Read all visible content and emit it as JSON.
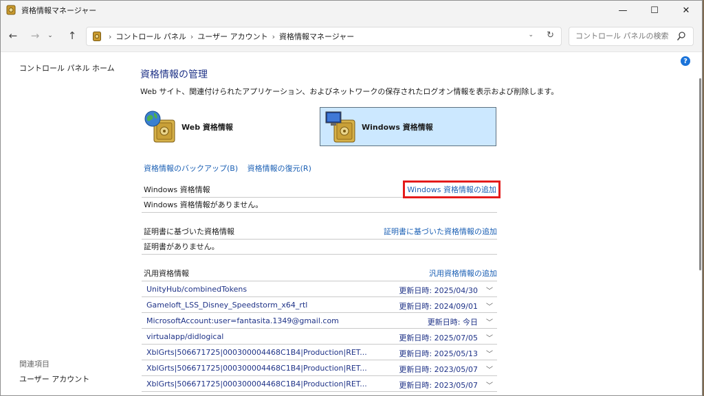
{
  "window": {
    "title": "資格情報マネージャー",
    "minimize": "—",
    "maximize": "☐",
    "close": "✕"
  },
  "nav": {
    "back": "←",
    "forward": "→",
    "recent": "⌄",
    "up": "↑",
    "breadcrumbs": [
      "コントロール パネル",
      "ユーザー アカウント",
      "資格情報マネージャー"
    ],
    "separator": "›",
    "dropdown": "⌄",
    "refresh": "↻",
    "search_placeholder": "コントロール パネルの検索"
  },
  "sidebar": {
    "home": "コントロール パネル ホーム",
    "related_heading": "関連項目",
    "related_user_accounts": "ユーザー アカウント"
  },
  "main": {
    "title": "資格情報の管理",
    "description": "Web サイト、関連付けられたアプリケーション、およびネットワークの保存されたログオン情報を表示および削除します。",
    "tiles": [
      {
        "label": "Web 資格情報",
        "selected": false
      },
      {
        "label": "Windows 資格情報",
        "selected": true
      }
    ],
    "backup_link": "資格情報のバックアップ(B)",
    "restore_link": "資格情報の復元(R)",
    "windows_section": {
      "heading": "Windows 資格情報",
      "add_link": "Windows 資格情報の追加",
      "empty_text": "Windows 資格情報がありません。"
    },
    "cert_section": {
      "heading": "証明書に基づいた資格情報",
      "add_link": "証明書に基づいた資格情報の追加",
      "empty_text": "証明書がありません。"
    },
    "generic_section": {
      "heading": "汎用資格情報",
      "add_link": "汎用資格情報の追加",
      "items": [
        {
          "name": "UnityHub/combinedTokens",
          "date": "更新日時:  2025/04/30"
        },
        {
          "name": "Gameloft_LSS_Disney_Speedstorm_x64_rtl",
          "date": "更新日時:  2024/09/01"
        },
        {
          "name": "MicrosoftAccount:user=fantasita.1349@gmail.com",
          "date": "更新日時:  今日"
        },
        {
          "name": "virtualapp/didlogical",
          "date": "更新日時:  2025/07/05"
        },
        {
          "name": "XblGrts|506671725|000300004468C1B4|Production|RET...",
          "date": "更新日時:  2025/05/13"
        },
        {
          "name": "XblGrts|506671725|000300004468C1B4|Production|RET...",
          "date": "更新日時:  2023/05/07"
        },
        {
          "name": "XblGrts|506671725|000300004468C1B4|Production|RET...",
          "date": "更新日時:  2023/05/07"
        }
      ]
    },
    "help": "?"
  },
  "colors": {
    "link": "#1a5fb4",
    "title": "#1e3287",
    "selected_tile": "#cce8ff",
    "highlight": "#e41b1b"
  }
}
